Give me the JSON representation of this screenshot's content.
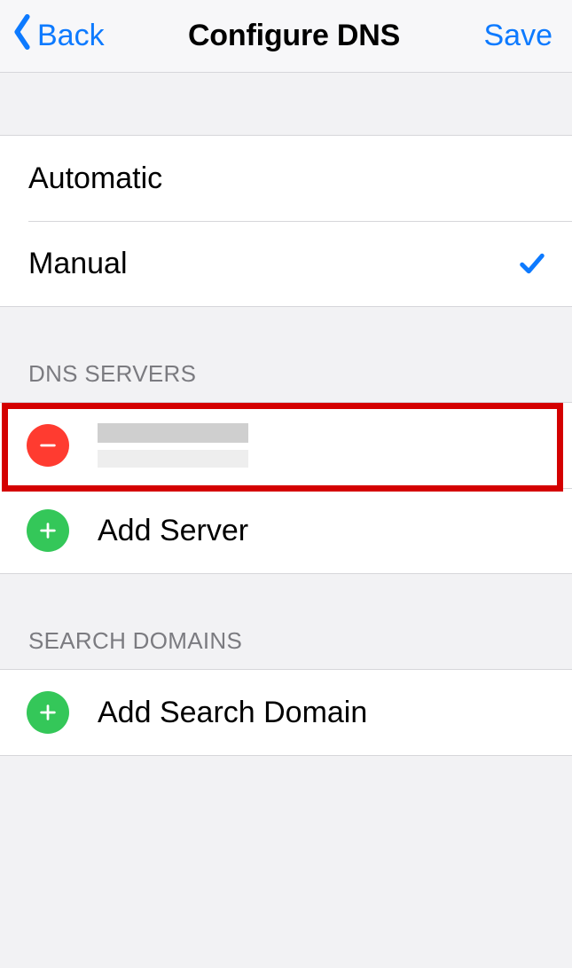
{
  "nav": {
    "back_label": "Back",
    "title": "Configure DNS",
    "save_label": "Save"
  },
  "mode": {
    "options": [
      {
        "label": "Automatic",
        "selected": false
      },
      {
        "label": "Manual",
        "selected": true
      }
    ]
  },
  "dns_section": {
    "header": "DNS SERVERS",
    "servers": [
      {
        "value_redacted": true
      }
    ],
    "add_label": "Add Server"
  },
  "search_section": {
    "header": "SEARCH DOMAINS",
    "add_label": "Add Search Domain"
  },
  "colors": {
    "tint": "#0d7aff",
    "delete": "#ff3b30",
    "add": "#34c759",
    "highlight": "#d40000"
  }
}
